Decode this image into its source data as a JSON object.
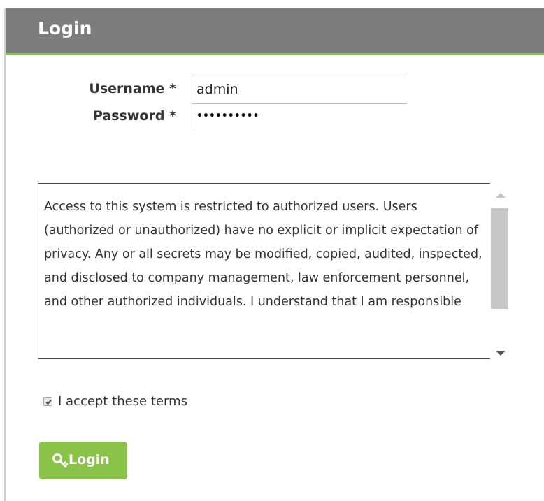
{
  "header": {
    "title": "Login"
  },
  "form": {
    "username_label": "Username",
    "password_label": "Password",
    "required_marker": "*",
    "username_value": "admin",
    "password_masked": "••••••••••"
  },
  "terms": {
    "text": "Access to this system is restricted to authorized users. Users (authorized or unauthorized) have no explicit or implicit expectation of privacy. Any or all secrets may be modified, copied, audited, inspected, and disclosed to company management, law enforcement personnel, and other authorized individuals. I understand that I am responsible"
  },
  "accept": {
    "label": "I accept these terms",
    "checked": true
  },
  "login_button": {
    "label": "Login",
    "icon": "key-icon"
  },
  "colors": {
    "header_bg": "#7d7d7d",
    "accent_green": "#8bc34a"
  }
}
